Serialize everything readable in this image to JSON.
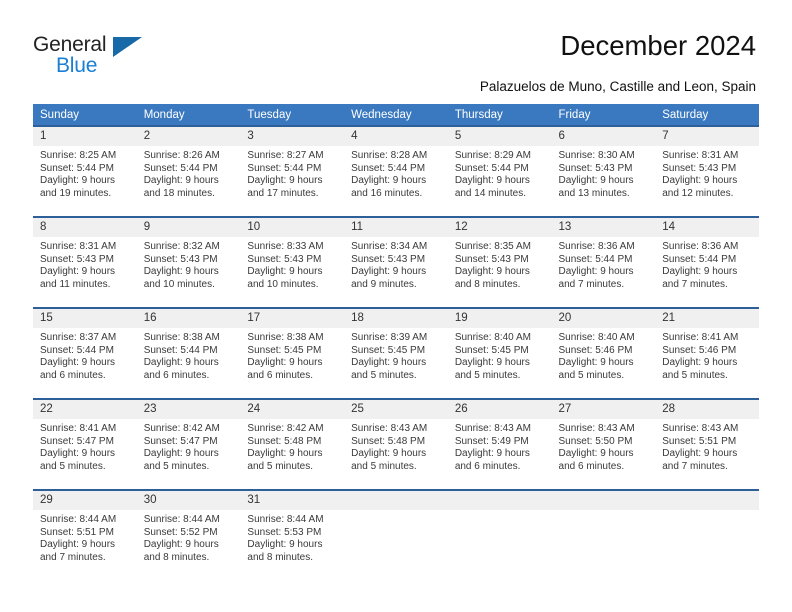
{
  "brand": {
    "name_part1": "General",
    "name_part2": "Blue"
  },
  "header": {
    "title": "December 2024",
    "subtitle": "Palazuelos de Muno, Castille and Leon, Spain"
  },
  "colors": {
    "header_blue": "#3a79bf",
    "row_border_blue": "#2d6099",
    "daynum_bg": "#f0f0f0",
    "brand_blue": "#1b7fd4",
    "triangle_blue": "#1769a8"
  },
  "weekdays": [
    "Sunday",
    "Monday",
    "Tuesday",
    "Wednesday",
    "Thursday",
    "Friday",
    "Saturday"
  ],
  "weeks": [
    [
      {
        "day": "1",
        "sunrise": "Sunrise: 8:25 AM",
        "sunset": "Sunset: 5:44 PM",
        "daylight1": "Daylight: 9 hours",
        "daylight2": "and 19 minutes."
      },
      {
        "day": "2",
        "sunrise": "Sunrise: 8:26 AM",
        "sunset": "Sunset: 5:44 PM",
        "daylight1": "Daylight: 9 hours",
        "daylight2": "and 18 minutes."
      },
      {
        "day": "3",
        "sunrise": "Sunrise: 8:27 AM",
        "sunset": "Sunset: 5:44 PM",
        "daylight1": "Daylight: 9 hours",
        "daylight2": "and 17 minutes."
      },
      {
        "day": "4",
        "sunrise": "Sunrise: 8:28 AM",
        "sunset": "Sunset: 5:44 PM",
        "daylight1": "Daylight: 9 hours",
        "daylight2": "and 16 minutes."
      },
      {
        "day": "5",
        "sunrise": "Sunrise: 8:29 AM",
        "sunset": "Sunset: 5:44 PM",
        "daylight1": "Daylight: 9 hours",
        "daylight2": "and 14 minutes."
      },
      {
        "day": "6",
        "sunrise": "Sunrise: 8:30 AM",
        "sunset": "Sunset: 5:43 PM",
        "daylight1": "Daylight: 9 hours",
        "daylight2": "and 13 minutes."
      },
      {
        "day": "7",
        "sunrise": "Sunrise: 8:31 AM",
        "sunset": "Sunset: 5:43 PM",
        "daylight1": "Daylight: 9 hours",
        "daylight2": "and 12 minutes."
      }
    ],
    [
      {
        "day": "8",
        "sunrise": "Sunrise: 8:31 AM",
        "sunset": "Sunset: 5:43 PM",
        "daylight1": "Daylight: 9 hours",
        "daylight2": "and 11 minutes."
      },
      {
        "day": "9",
        "sunrise": "Sunrise: 8:32 AM",
        "sunset": "Sunset: 5:43 PM",
        "daylight1": "Daylight: 9 hours",
        "daylight2": "and 10 minutes."
      },
      {
        "day": "10",
        "sunrise": "Sunrise: 8:33 AM",
        "sunset": "Sunset: 5:43 PM",
        "daylight1": "Daylight: 9 hours",
        "daylight2": "and 10 minutes."
      },
      {
        "day": "11",
        "sunrise": "Sunrise: 8:34 AM",
        "sunset": "Sunset: 5:43 PM",
        "daylight1": "Daylight: 9 hours",
        "daylight2": "and 9 minutes."
      },
      {
        "day": "12",
        "sunrise": "Sunrise: 8:35 AM",
        "sunset": "Sunset: 5:43 PM",
        "daylight1": "Daylight: 9 hours",
        "daylight2": "and 8 minutes."
      },
      {
        "day": "13",
        "sunrise": "Sunrise: 8:36 AM",
        "sunset": "Sunset: 5:44 PM",
        "daylight1": "Daylight: 9 hours",
        "daylight2": "and 7 minutes."
      },
      {
        "day": "14",
        "sunrise": "Sunrise: 8:36 AM",
        "sunset": "Sunset: 5:44 PM",
        "daylight1": "Daylight: 9 hours",
        "daylight2": "and 7 minutes."
      }
    ],
    [
      {
        "day": "15",
        "sunrise": "Sunrise: 8:37 AM",
        "sunset": "Sunset: 5:44 PM",
        "daylight1": "Daylight: 9 hours",
        "daylight2": "and 6 minutes."
      },
      {
        "day": "16",
        "sunrise": "Sunrise: 8:38 AM",
        "sunset": "Sunset: 5:44 PM",
        "daylight1": "Daylight: 9 hours",
        "daylight2": "and 6 minutes."
      },
      {
        "day": "17",
        "sunrise": "Sunrise: 8:38 AM",
        "sunset": "Sunset: 5:45 PM",
        "daylight1": "Daylight: 9 hours",
        "daylight2": "and 6 minutes."
      },
      {
        "day": "18",
        "sunrise": "Sunrise: 8:39 AM",
        "sunset": "Sunset: 5:45 PM",
        "daylight1": "Daylight: 9 hours",
        "daylight2": "and 5 minutes."
      },
      {
        "day": "19",
        "sunrise": "Sunrise: 8:40 AM",
        "sunset": "Sunset: 5:45 PM",
        "daylight1": "Daylight: 9 hours",
        "daylight2": "and 5 minutes."
      },
      {
        "day": "20",
        "sunrise": "Sunrise: 8:40 AM",
        "sunset": "Sunset: 5:46 PM",
        "daylight1": "Daylight: 9 hours",
        "daylight2": "and 5 minutes."
      },
      {
        "day": "21",
        "sunrise": "Sunrise: 8:41 AM",
        "sunset": "Sunset: 5:46 PM",
        "daylight1": "Daylight: 9 hours",
        "daylight2": "and 5 minutes."
      }
    ],
    [
      {
        "day": "22",
        "sunrise": "Sunrise: 8:41 AM",
        "sunset": "Sunset: 5:47 PM",
        "daylight1": "Daylight: 9 hours",
        "daylight2": "and 5 minutes."
      },
      {
        "day": "23",
        "sunrise": "Sunrise: 8:42 AM",
        "sunset": "Sunset: 5:47 PM",
        "daylight1": "Daylight: 9 hours",
        "daylight2": "and 5 minutes."
      },
      {
        "day": "24",
        "sunrise": "Sunrise: 8:42 AM",
        "sunset": "Sunset: 5:48 PM",
        "daylight1": "Daylight: 9 hours",
        "daylight2": "and 5 minutes."
      },
      {
        "day": "25",
        "sunrise": "Sunrise: 8:43 AM",
        "sunset": "Sunset: 5:48 PM",
        "daylight1": "Daylight: 9 hours",
        "daylight2": "and 5 minutes."
      },
      {
        "day": "26",
        "sunrise": "Sunrise: 8:43 AM",
        "sunset": "Sunset: 5:49 PM",
        "daylight1": "Daylight: 9 hours",
        "daylight2": "and 6 minutes."
      },
      {
        "day": "27",
        "sunrise": "Sunrise: 8:43 AM",
        "sunset": "Sunset: 5:50 PM",
        "daylight1": "Daylight: 9 hours",
        "daylight2": "and 6 minutes."
      },
      {
        "day": "28",
        "sunrise": "Sunrise: 8:43 AM",
        "sunset": "Sunset: 5:51 PM",
        "daylight1": "Daylight: 9 hours",
        "daylight2": "and 7 minutes."
      }
    ],
    [
      {
        "day": "29",
        "sunrise": "Sunrise: 8:44 AM",
        "sunset": "Sunset: 5:51 PM",
        "daylight1": "Daylight: 9 hours",
        "daylight2": "and 7 minutes."
      },
      {
        "day": "30",
        "sunrise": "Sunrise: 8:44 AM",
        "sunset": "Sunset: 5:52 PM",
        "daylight1": "Daylight: 9 hours",
        "daylight2": "and 8 minutes."
      },
      {
        "day": "31",
        "sunrise": "Sunrise: 8:44 AM",
        "sunset": "Sunset: 5:53 PM",
        "daylight1": "Daylight: 9 hours",
        "daylight2": "and 8 minutes."
      },
      {
        "day": "",
        "sunrise": "",
        "sunset": "",
        "daylight1": "",
        "daylight2": ""
      },
      {
        "day": "",
        "sunrise": "",
        "sunset": "",
        "daylight1": "",
        "daylight2": ""
      },
      {
        "day": "",
        "sunrise": "",
        "sunset": "",
        "daylight1": "",
        "daylight2": ""
      },
      {
        "day": "",
        "sunrise": "",
        "sunset": "",
        "daylight1": "",
        "daylight2": ""
      }
    ]
  ]
}
